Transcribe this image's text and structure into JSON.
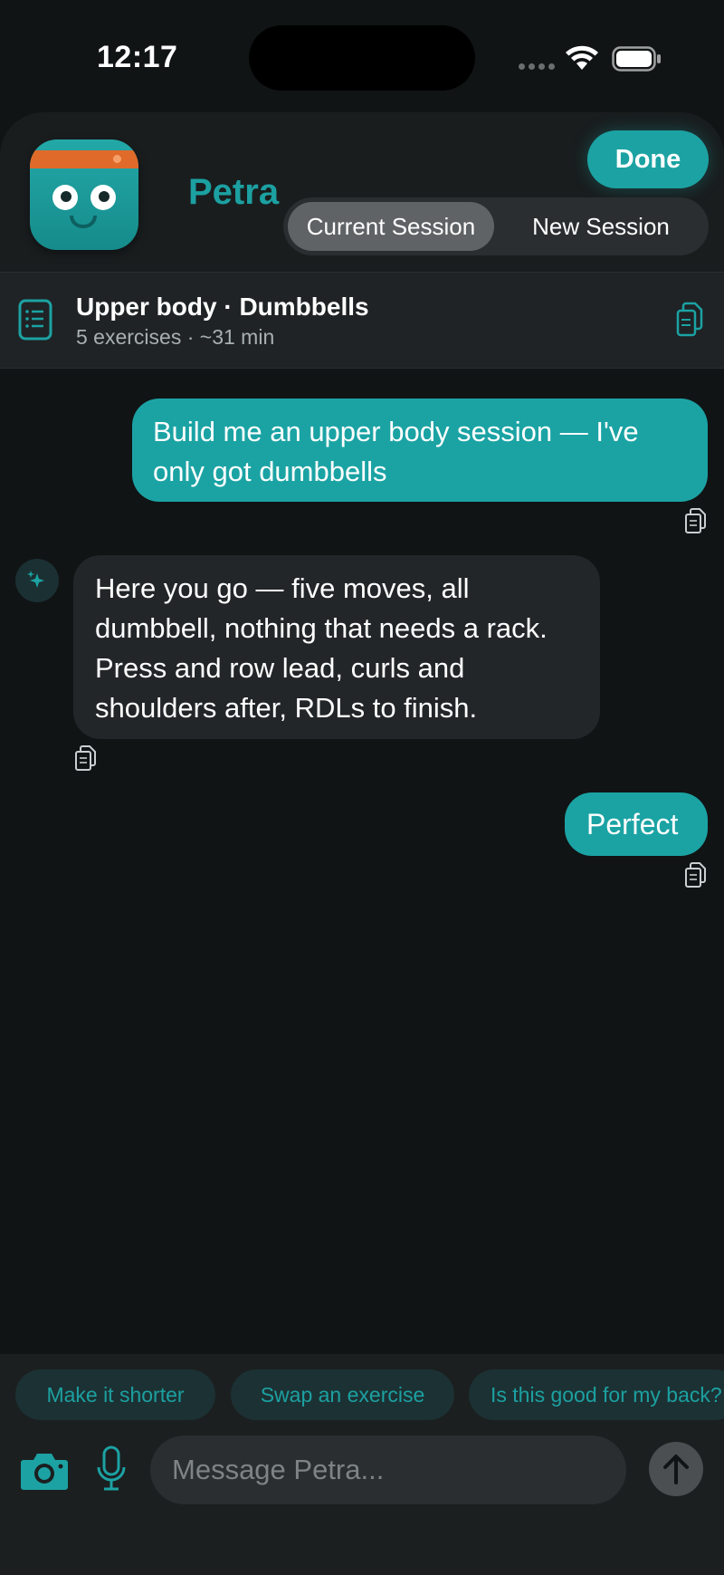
{
  "status_bar": {
    "time": "12:17"
  },
  "header": {
    "app_name": "Petra",
    "done_label": "Done",
    "segments": [
      "Current Session",
      "New Session"
    ],
    "active_segment": "Current Session"
  },
  "session": {
    "title": "Upper body · Dumbbells",
    "meta": "5 exercises · ~31 min"
  },
  "messages": [
    {
      "role": "user",
      "text": "Build me an upper body session — I've only got dumbbells"
    },
    {
      "role": "assistant",
      "text": "Here you go — five moves, all dumbbell, nothing that needs a rack. Press and row lead, curls and shoulders after, RDLs to finish."
    },
    {
      "role": "user",
      "text": "Perfect"
    }
  ],
  "suggestions": [
    "Make it shorter",
    "Swap an exercise",
    "Is this good for my back?"
  ],
  "composer": {
    "placeholder": "Message Petra..."
  },
  "colors": {
    "accent": "#1ca2a3",
    "background": "#111415",
    "assistant_bubble": "#222628",
    "user_bubble": "#1ba3a4"
  },
  "icons": [
    "document-icon",
    "copy-icon",
    "sparkle-icon",
    "camera-icon",
    "microphone-icon",
    "send-arrow-icon",
    "wifi-icon",
    "battery-icon"
  ]
}
